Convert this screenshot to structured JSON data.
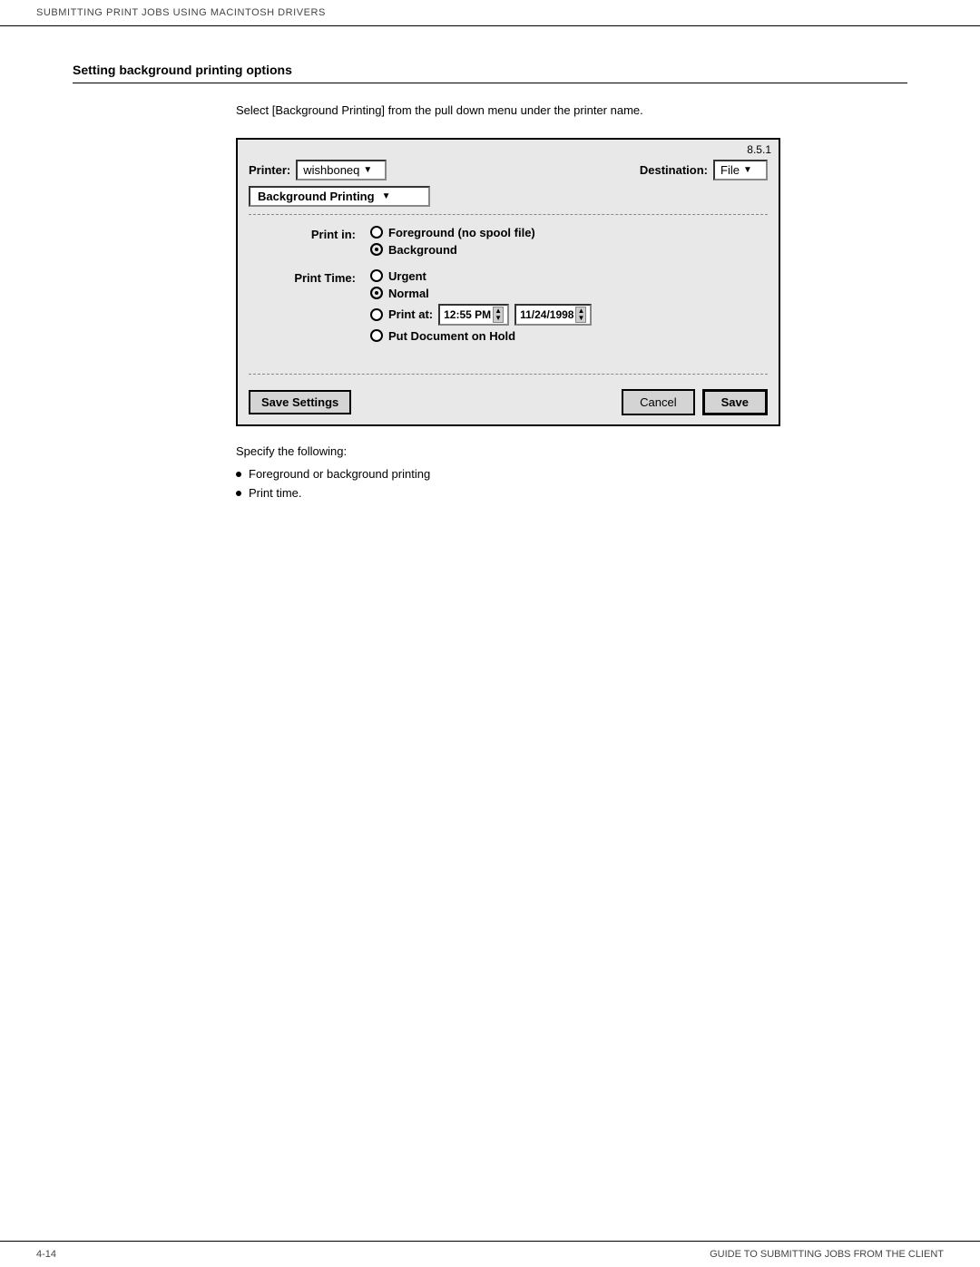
{
  "header": {
    "text": "SUBMITTING PRINT JOBS USING MACINTOSH DRIVERS"
  },
  "footer": {
    "left": "4-14",
    "right": "GUIDE TO SUBMITTING JOBS FROM THE CLIENT"
  },
  "section": {
    "heading": "Setting background printing options"
  },
  "intro": {
    "text": "Select [Background Printing] from the pull down menu under the printer name."
  },
  "dialog": {
    "version": "8.5.1",
    "printer_label": "Printer:",
    "printer_value": "wishboneq",
    "destination_label": "Destination:",
    "destination_value": "File",
    "bg_printing_label": "Background Printing",
    "print_in_label": "Print in:",
    "print_in_options": [
      {
        "label": "Foreground (no spool file)",
        "selected": false
      },
      {
        "label": "Background",
        "selected": true
      }
    ],
    "print_time_label": "Print Time:",
    "print_time_options": [
      {
        "label": "Urgent",
        "selected": false
      },
      {
        "label": "Normal",
        "selected": true
      },
      {
        "label": "Print at:",
        "selected": false,
        "has_input": true,
        "time_value": "12:55 PM",
        "date_value": "11/24/1998"
      },
      {
        "label": "Put Document on Hold",
        "selected": false
      }
    ],
    "save_settings_label": "Save Settings",
    "cancel_label": "Cancel",
    "save_label": "Save"
  },
  "instructions": {
    "specify_text": "Specify the following:",
    "bullets": [
      "Foreground or background printing",
      "Print time."
    ]
  }
}
